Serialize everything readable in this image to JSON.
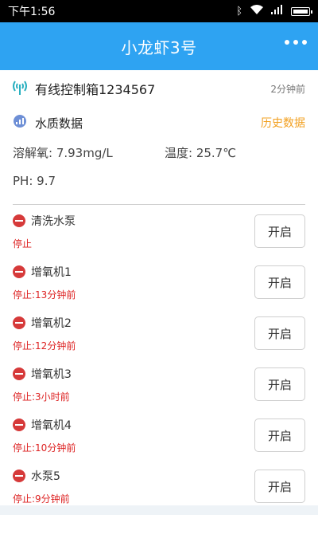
{
  "status_bar": {
    "time": "下午1:56"
  },
  "app_bar": {
    "title": "小龙虾3号"
  },
  "device": {
    "name": "有线控制箱1234567",
    "time": "2分钟前"
  },
  "water_quality": {
    "title": "水质数据",
    "history_link": "历史数据",
    "oxygen": "溶解氧: 7.93mg/L",
    "temperature": "温度: 25.7℃",
    "ph": "PH: 9.7"
  },
  "devices": [
    {
      "name": "清洗水泵",
      "status": "停止",
      "button": "开启"
    },
    {
      "name": "增氧机1",
      "status": "停止:13分钟前",
      "button": "开启"
    },
    {
      "name": "增氧机2",
      "status": "停止:12分钟前",
      "button": "开启"
    },
    {
      "name": "增氧机3",
      "status": "停止:3小时前",
      "button": "开启"
    },
    {
      "name": "增氧机4",
      "status": "停止:10分钟前",
      "button": "开启"
    },
    {
      "name": "水泵5",
      "status": "停止:9分钟前",
      "button": "开启"
    }
  ],
  "colors": {
    "app_bar": "#2ea3f2",
    "link": "#f2a020",
    "stop": "#d63a3a"
  }
}
